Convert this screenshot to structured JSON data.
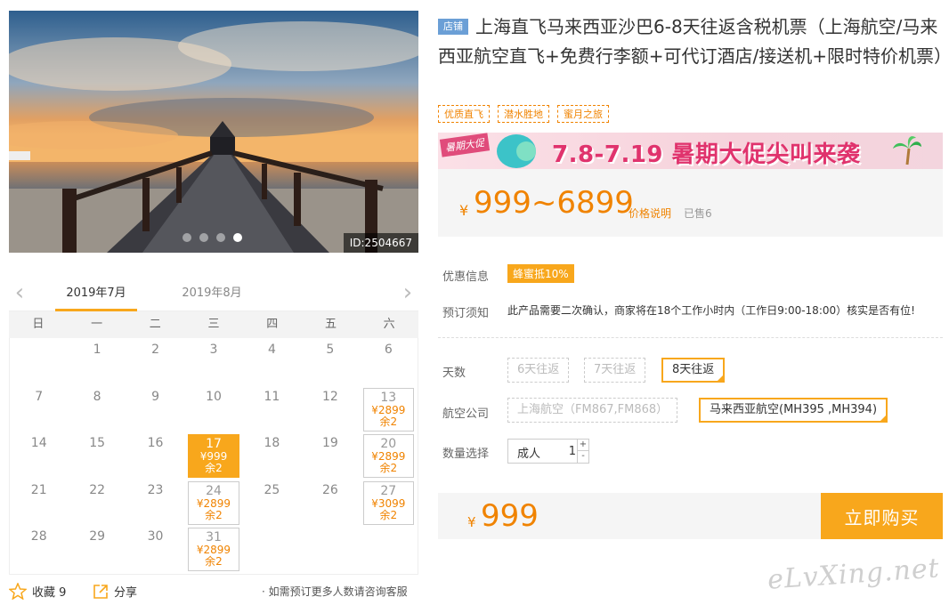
{
  "photo": {
    "id_label": "ID:2504667",
    "dots": [
      {
        "active": false
      },
      {
        "active": false
      },
      {
        "active": false
      },
      {
        "active": true
      }
    ]
  },
  "calendar": {
    "prev_icon": "chevron-left-icon",
    "next_icon": "chevron-right-icon",
    "months": [
      "2019年7月",
      "2019年8月"
    ],
    "weekdays": [
      "日",
      "一",
      "二",
      "三",
      "四",
      "五",
      "六"
    ],
    "days": [
      {
        "day": ""
      },
      {
        "day": "1"
      },
      {
        "day": "2"
      },
      {
        "day": "3"
      },
      {
        "day": "4"
      },
      {
        "day": "5"
      },
      {
        "day": "6"
      },
      {
        "day": "7"
      },
      {
        "day": "8"
      },
      {
        "day": "9"
      },
      {
        "day": "10"
      },
      {
        "day": "11"
      },
      {
        "day": "12"
      },
      {
        "day": "13",
        "price": "¥2899",
        "remain": "余2"
      },
      {
        "day": "14"
      },
      {
        "day": "15"
      },
      {
        "day": "16"
      },
      {
        "day": "17",
        "price": "¥999",
        "remain": "余2",
        "selected": true
      },
      {
        "day": "18"
      },
      {
        "day": "19"
      },
      {
        "day": "20",
        "price": "¥2899",
        "remain": "余2"
      },
      {
        "day": "21"
      },
      {
        "day": "22"
      },
      {
        "day": "23"
      },
      {
        "day": "24",
        "price": "¥2899",
        "remain": "余2"
      },
      {
        "day": "25"
      },
      {
        "day": "26"
      },
      {
        "day": "27",
        "price": "¥3099",
        "remain": "余2"
      },
      {
        "day": "28"
      },
      {
        "day": "29"
      },
      {
        "day": "30"
      },
      {
        "day": "31",
        "price": "¥2899",
        "remain": "余2"
      },
      {
        "day": ""
      },
      {
        "day": ""
      },
      {
        "day": ""
      }
    ]
  },
  "actions": {
    "favorite_label": "收藏 9",
    "share_label": "分享",
    "consult_text": "· 如需预订更多人数请咨询客服"
  },
  "product": {
    "shop_badge": "店铺",
    "title": "上海直飞马来西亚沙巴6-8天往返含税机票（上海航空/马来西亚航空直飞+免费行李额+可代订酒店/接送机+限时特价机票）",
    "tags": [
      "优质直飞",
      "潜水胜地",
      "蜜月之旅"
    ]
  },
  "banner": {
    "label": "暑期大促",
    "text": "7.8-7.19 暑期大促尖叫来袭"
  },
  "price": {
    "currency": "¥",
    "range": "999~6899",
    "explain_link": "价格说明",
    "sold": "已售6"
  },
  "info": {
    "promo_label": "优惠信息",
    "promo_badge": "蜂蜜抵10%",
    "notice_label": "预订须知",
    "notice_text": "此产品需要二次确认，商家将在18个工作小时内（工作日9:00-18:00）核实是否有位!"
  },
  "options": {
    "days_label": "天数",
    "days": [
      {
        "label": "6天往返"
      },
      {
        "label": "7天往返"
      },
      {
        "label": "8天往返",
        "selected": true
      }
    ],
    "airline_label": "航空公司",
    "airlines": [
      {
        "label": "上海航空（FM867,FM868）"
      },
      {
        "label": "马来西亚航空(MH395 ,MH394)",
        "selected": true
      }
    ],
    "qty_label": "数量选择",
    "qty_type": "成人",
    "qty_value": "1",
    "plus": "+",
    "minus": "-"
  },
  "buy": {
    "currency": "¥",
    "amount": "999",
    "button": "立即购买"
  },
  "watermark": "eLvXing.net",
  "colors": {
    "accent": "#f8a71c",
    "price": "#f08300",
    "badge": "#6b9fd6"
  }
}
